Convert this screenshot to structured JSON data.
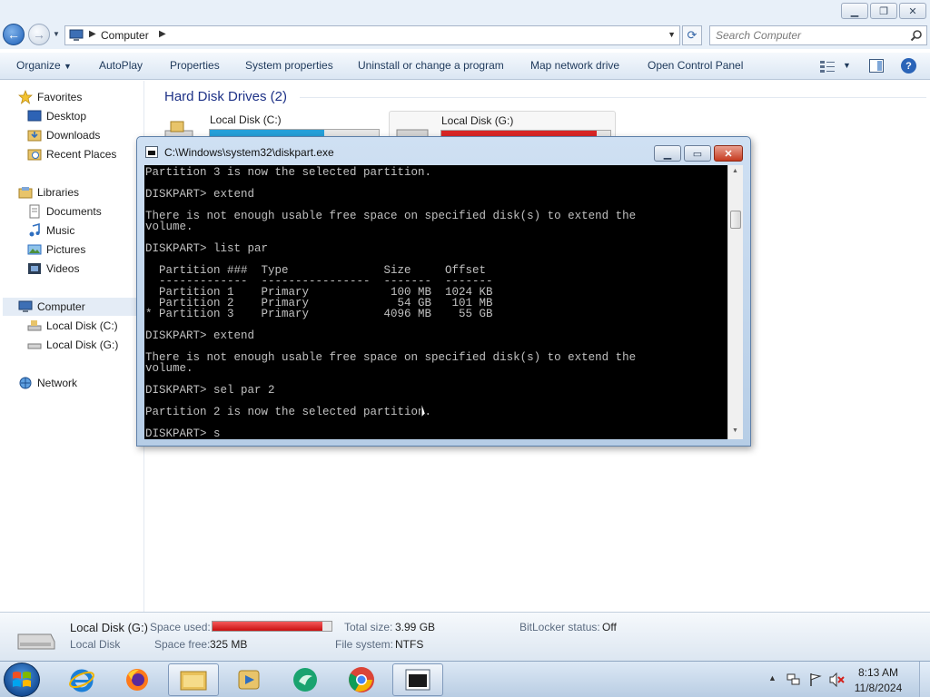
{
  "explorer": {
    "address": {
      "location": "Computer"
    },
    "search": {
      "placeholder": "Search Computer"
    },
    "toolbar": {
      "organize": "Organize",
      "autoplay": "AutoPlay",
      "properties": "Properties",
      "system_properties": "System properties",
      "uninstall": "Uninstall or change a program",
      "map_drive": "Map network drive",
      "control_panel": "Open Control Panel"
    },
    "nav": {
      "favorites": "Favorites",
      "desktop": "Desktop",
      "downloads": "Downloads",
      "recent_places": "Recent Places",
      "libraries": "Libraries",
      "documents": "Documents",
      "music": "Music",
      "pictures": "Pictures",
      "videos": "Videos",
      "computer": "Computer",
      "local_c": "Local Disk (C:)",
      "local_g": "Local Disk (G:)",
      "network": "Network"
    },
    "content": {
      "group_header": "Hard Disk Drives (2)",
      "drives": [
        {
          "label": "Local Disk (C:)",
          "used_fraction": 0.68,
          "bar_color": "#26a0da"
        },
        {
          "label": "Local Disk (G:)",
          "used_fraction": 0.92,
          "bar_color": "#da2626"
        }
      ]
    },
    "details": {
      "name": "Local Disk (G:)",
      "type": "Local Disk",
      "space_used_label": "Space used:",
      "space_used_fraction": 0.92,
      "space_free_label": "Space free:",
      "space_free_value": "325 MB",
      "total_size_label": "Total size:",
      "total_size_value": "3.99 GB",
      "file_system_label": "File system:",
      "file_system_value": "NTFS",
      "bitlocker_label": "BitLocker status:",
      "bitlocker_value": "Off"
    }
  },
  "cmd": {
    "title": "C:\\Windows\\system32\\diskpart.exe",
    "lines": [
      "Partition 3 is now the selected partition.",
      "",
      "DISKPART> extend",
      "",
      "There is not enough usable free space on specified disk(s) to extend the",
      "volume.",
      "",
      "DISKPART> list par",
      "",
      "  Partition ###  Type              Size     Offset",
      "  -------------  ----------------  -------  -------",
      "  Partition 1    Primary            100 MB  1024 KB",
      "  Partition 2    Primary             54 GB   101 MB",
      "* Partition 3    Primary           4096 MB    55 GB",
      "",
      "DISKPART> extend",
      "",
      "There is not enough usable free space on specified disk(s) to extend the",
      "volume.",
      "",
      "DISKPART> sel par 2",
      "",
      "Partition 2 is now the selected partition.",
      "",
      "DISKPART> s"
    ]
  },
  "taskbar": {
    "clock_time": "8:13 AM",
    "clock_date": "11/8/2024"
  }
}
